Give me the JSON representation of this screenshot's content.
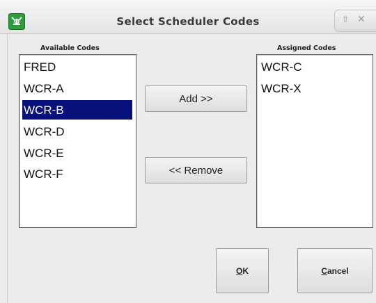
{
  "window": {
    "title": "Select Scheduler Codes",
    "icons": {
      "app": "app-logo-icon",
      "up": "arrow-up-icon",
      "close": "close-icon"
    },
    "up_glyph": "⇧",
    "close_glyph": "✕"
  },
  "available": {
    "heading": "Available Codes",
    "items": [
      "FRED",
      "WCR-A",
      "WCR-B",
      "WCR-D",
      "WCR-E",
      "WCR-F"
    ],
    "selected": "WCR-B"
  },
  "assigned": {
    "heading": "Assigned Codes",
    "items": [
      "WCR-C",
      "WCR-X"
    ]
  },
  "buttons": {
    "add": "Add >>",
    "remove": "<< Remove",
    "ok": {
      "mnemonic": "O",
      "rest": "K"
    },
    "cancel": {
      "mnemonic": "C",
      "rest": "ancel"
    }
  },
  "colors": {
    "selection": "#08107c",
    "selection_text": "#ffffff",
    "app_icon": "#2e9b3c"
  }
}
